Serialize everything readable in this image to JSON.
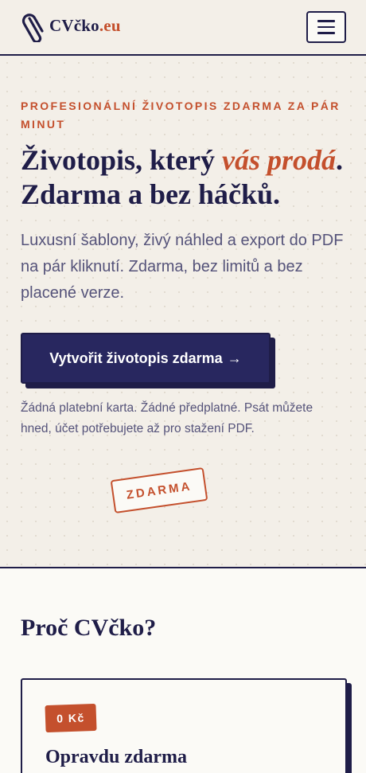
{
  "header": {
    "logo_text": "CVčko",
    "logo_tld": ".eu",
    "logo_icon": "paperclip-icon",
    "menu_icon": "hamburger-menu-icon"
  },
  "hero": {
    "eyebrow": "Profesionální životopis zdarma za pár minut",
    "headline_part1": "Životopis, který ",
    "headline_accent": "vás prodá",
    "headline_part2": ".",
    "headline_line2": "Zdarma a bez háčků.",
    "lead": "Luxusní šablony, živý náhled a export do PDF na pár kliknutí. Zdarma, bez limitů a bez placené verze.",
    "cta_label": "Vytvořit životopis zdarma",
    "cta_arrow": "→",
    "note": "Žádná platební karta. Žádné předplatné. Psát můžete hned, účet potřebujete až pro stažení PDF.",
    "stamp": "ZDARMA"
  },
  "why": {
    "title": "Proč CVčko?",
    "cards": [
      {
        "badge": "0 Kč",
        "title": "Opravdu zdarma"
      }
    ]
  },
  "colors": {
    "navy": "#1f1d48",
    "button": "#28275f",
    "accent": "#c4502d",
    "hero_bg": "#f3efe8",
    "page_bg": "#fbfaf6",
    "muted_text": "#55537a"
  }
}
